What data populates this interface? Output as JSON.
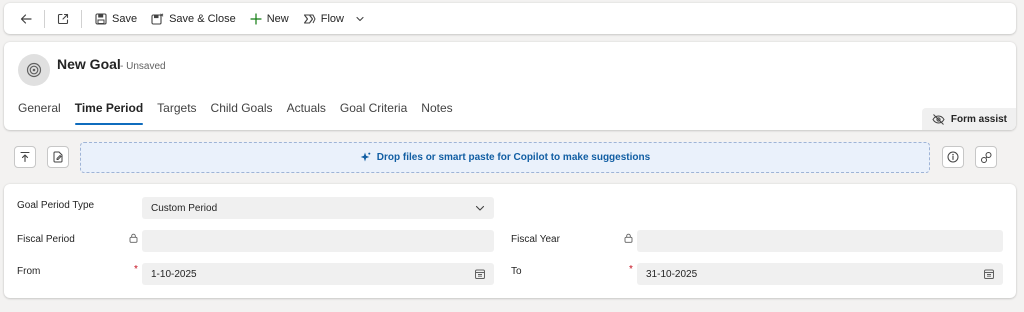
{
  "commandbar": {
    "save_label": "Save",
    "save_close_label": "Save & Close",
    "new_label": "New",
    "flow_label": "Flow"
  },
  "header": {
    "title": "New Goal",
    "status": "- Unsaved",
    "form_assist_label": "Form assist",
    "tabs": [
      "General",
      "Time Period",
      "Targets",
      "Child Goals",
      "Actuals",
      "Goal Criteria",
      "Notes"
    ],
    "active_tab": "Time Period"
  },
  "copilot": {
    "dropzone_text": "Drop files or smart paste for Copilot to make suggestions"
  },
  "form": {
    "goal_period_type": {
      "label": "Goal Period Type",
      "value": "Custom Period"
    },
    "fiscal_period": {
      "label": "Fiscal Period",
      "value": ""
    },
    "fiscal_year": {
      "label": "Fiscal Year",
      "value": ""
    },
    "from": {
      "label": "From",
      "value": "1-10-2025",
      "required_mark": "*"
    },
    "to": {
      "label": "To",
      "value": "31-10-2025",
      "required_mark": "*"
    }
  },
  "colors": {
    "accent": "#0f6cbd",
    "required": "#c50f1f",
    "dropzone_bg": "#eaf1fb"
  }
}
